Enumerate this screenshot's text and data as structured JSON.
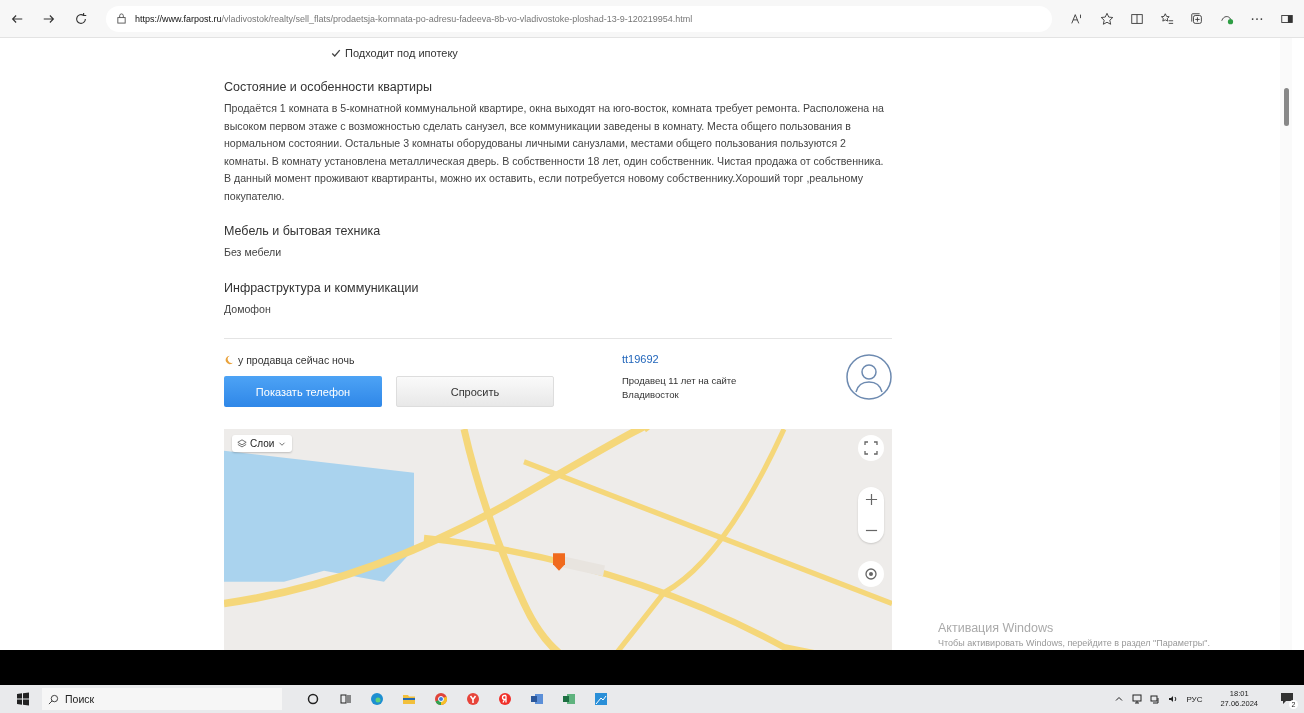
{
  "browser": {
    "url_host": "https://www.farpost.ru",
    "url_path": "/vladivostok/realty/sell_flats/prodaetsja-komnata-po-adresu-fadeeva-8b-vo-vladivostoke-ploshad-13-9-120219954.html"
  },
  "features": [
    {
      "label": "Подходит под ипотеку",
      "checked": true
    }
  ],
  "sections": [
    {
      "title": "Состояние и особенности квартиры",
      "text": "Продаётся 1 комната в 5-комнатной коммунальной квартире, окна выходят на юго-восток, комната требует ремонта. Расположена на высоком первом этаже с возможностью сделать санузел, все коммуникации заведены в комнату. Места общего пользования в нормальном состоянии. Остальные 3 комнаты оборудованы личными санузлами, местами общего пользования пользуются 2 комнаты. В комнату установлена металлическая дверь. В собственности 18 лет, один собственник. Чистая продажа от собственника. В данный момент проживают квартиранты, можно их оставить, если потребуется новому собственнику.Хороший торг ,реальному покупателю."
    },
    {
      "title": "Мебель и бытовая техника",
      "text": "Без мебели"
    },
    {
      "title": "Инфраструктура и коммуникации",
      "text": "Домофон"
    }
  ],
  "seller": {
    "night_note": "у продавца сейчас ночь",
    "show_phone_button": "Показать телефон",
    "ask_button": "Спросить",
    "name": "tt19692",
    "since": "Продавец 11 лет на сайте",
    "city": "Владивосток"
  },
  "map": {
    "layers_button": "Слои"
  },
  "activation": {
    "title": "Активация Windows",
    "text": "Чтобы активировать Windows, перейдите в раздел \"Параметры\"."
  },
  "taskbar": {
    "search_placeholder": "Поиск",
    "language": "РУС",
    "time": "18:01",
    "date": "27.06.2024",
    "notifications": "2"
  }
}
